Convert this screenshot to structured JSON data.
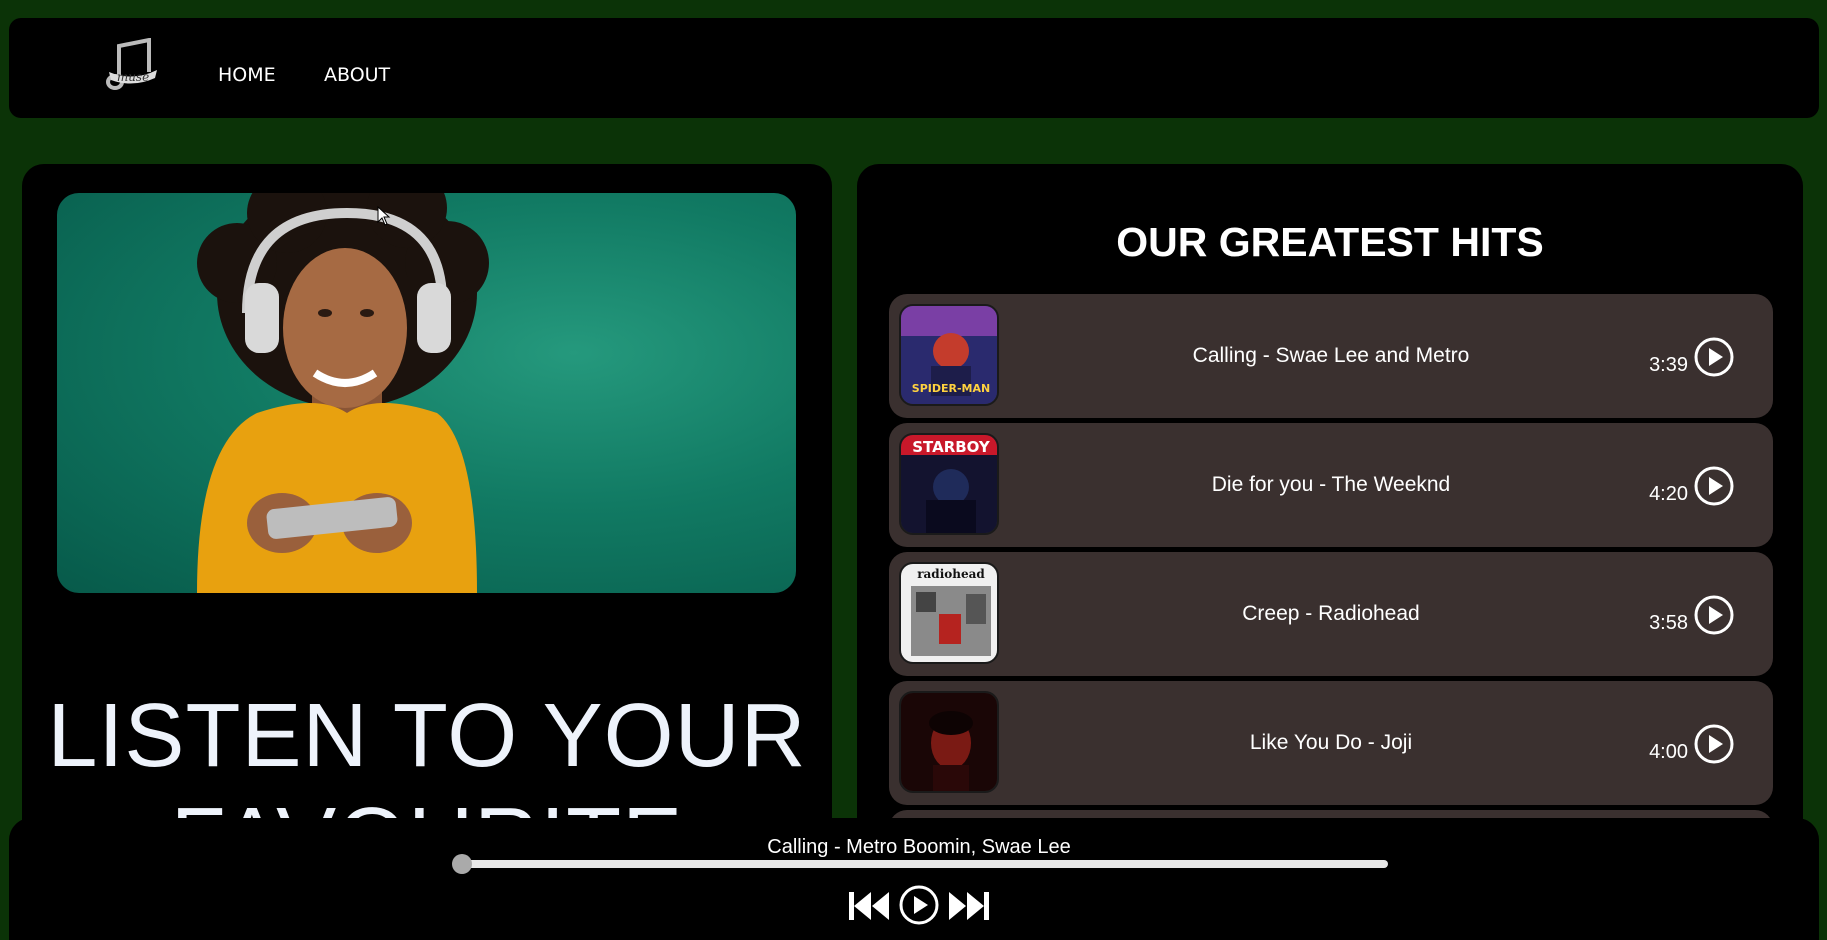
{
  "nav": {
    "logo_text": "muse",
    "links": [
      "HOME",
      "ABOUT"
    ]
  },
  "hero": {
    "title_line1": "LISTEN TO YOUR",
    "title_line2": "FAVOURITE"
  },
  "hits": {
    "title": "OUR GREATEST HITS",
    "tracks": [
      {
        "title": "Calling - Swae Lee and Metro",
        "duration": "3:39"
      },
      {
        "title": "Die for you - The Weeknd",
        "duration": "4:20"
      },
      {
        "title": "Creep - Radiohead",
        "duration": "3:58"
      },
      {
        "title": "Like You Do - Joji",
        "duration": "4:00"
      }
    ],
    "art_labels": [
      "SPIDER-MAN",
      "STARBOY",
      "radiohead",
      ""
    ]
  },
  "player": {
    "now_playing": "Calling - Metro Boomin, Swae Lee",
    "progress": 0
  },
  "colors": {
    "page_bg": "#0b3307",
    "card_bg": "#000000",
    "track_bg": "#3a302f",
    "hero_bg": "#117a63",
    "sweater": "#e8a10f"
  },
  "icons": [
    "music-note-logo-icon",
    "play-circle-icon",
    "skip-back-icon",
    "play-icon",
    "skip-forward-icon"
  ]
}
